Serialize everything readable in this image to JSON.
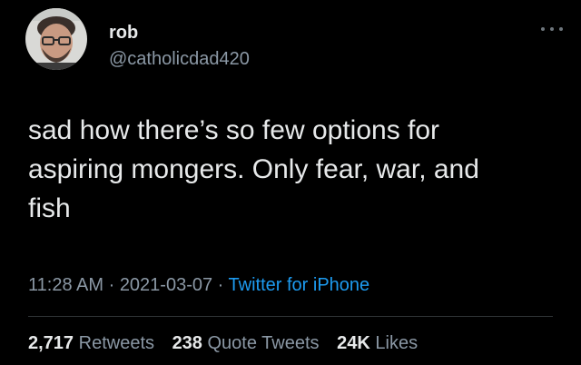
{
  "author": {
    "display_name": "rob",
    "handle": "@catholicdad420",
    "avatar_icon": "profile-photo"
  },
  "tweet": {
    "text": "sad how there’s so few options for\naspiring mongers. Only fear, war, and\nfish",
    "time": "11:28 AM",
    "separator": " · ",
    "date": "2021-03-07",
    "source": "Twitter for iPhone"
  },
  "stats": {
    "retweets_count": "2,717",
    "retweets_label": "Retweets",
    "quotes_count": "238",
    "quotes_label": "Quote Tweets",
    "likes_count": "24K",
    "likes_label": "Likes"
  },
  "colors": {
    "background": "#000000",
    "text": "#e7e9ea",
    "secondary": "#8b98a5",
    "link": "#1d9bf0"
  },
  "icons": {
    "more": "more-horizontal-icon"
  }
}
